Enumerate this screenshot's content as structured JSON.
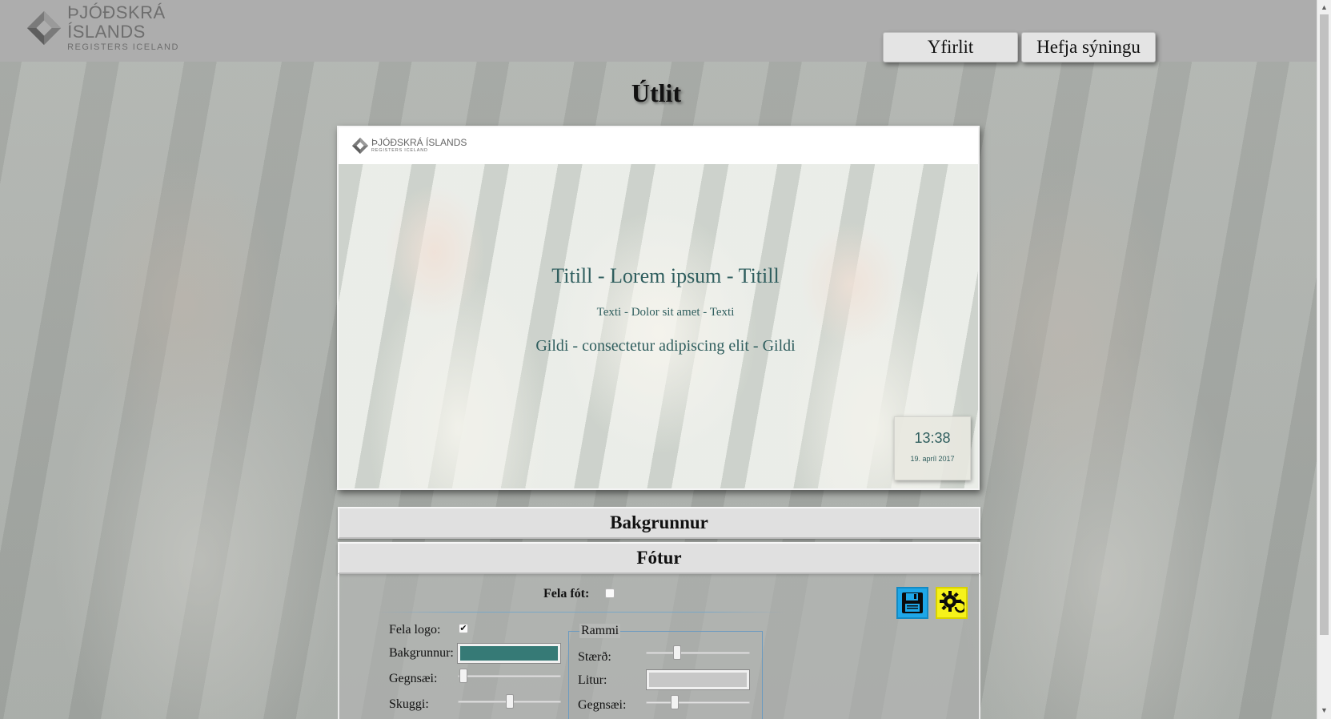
{
  "brand": {
    "name": "ÞJÓÐSKRÁ ÍSLANDS",
    "subtitle": "REGISTERS ICELAND"
  },
  "nav": {
    "overview_label": "Yfirlit",
    "start_label": "Hefja sýningu"
  },
  "page": {
    "title": "Útlit"
  },
  "preview": {
    "header_brand": "ÞJÓÐSKRÁ ÍSLANDS",
    "header_subtitle": "REGISTERS ICELAND",
    "title": "Titill - Lorem ipsum - Titill",
    "text": "Texti - Dolor sit amet - Texti",
    "value": "Gildi - consectetur adipiscing elit - Gildi",
    "clock_time": "13:38",
    "clock_date": "19. apríl 2017",
    "text_color": "#2f5e5e"
  },
  "sections": {
    "background": "Bakgrunnur",
    "footer": "Fótur"
  },
  "footer_settings": {
    "hide_footer_label": "Fela fót:",
    "hide_footer_checked": false,
    "hide_logo_label": "Fela logo:",
    "hide_logo_checked": true,
    "background_label": "Bakgrunnur:",
    "background_color": "#367a76",
    "opacity_label": "Gegnsæi:",
    "opacity_value": 0.02,
    "shadow_label": "Skuggi:",
    "shadow_value": 0.5,
    "frame": {
      "legend": "Rammi",
      "size_label": "Stærð:",
      "size_value": 0.28,
      "color_label": "Litur:",
      "color_value": "#c7c7c7",
      "opacity_label": "Gegnsæi:",
      "opacity_value": 0.26
    },
    "save_icon": "floppy-disk-icon",
    "settings_icon": "gear-reset-icon"
  }
}
